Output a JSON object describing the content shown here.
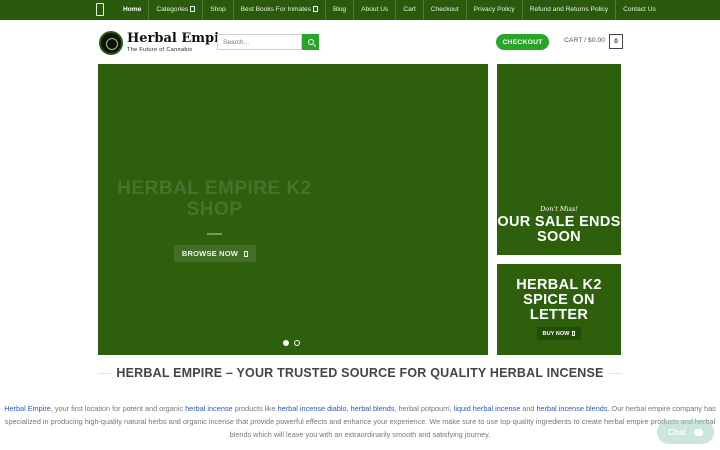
{
  "nav": {
    "items": [
      {
        "label": "Home"
      },
      {
        "label": "Categories"
      },
      {
        "label": "Shop"
      },
      {
        "label": "Best Books For Inmates"
      },
      {
        "label": "Blog"
      },
      {
        "label": "About Us"
      },
      {
        "label": "Cart"
      },
      {
        "label": "Checkout"
      },
      {
        "label": "Privacy Policy"
      },
      {
        "label": "Refund and Returns Policy"
      },
      {
        "label": "Contact Us"
      }
    ]
  },
  "header": {
    "logo_title": "Herbal Empire",
    "logo_subtitle": "The Future of Cannabis",
    "search_placeholder": "Search...",
    "checkout_label": "CHECKOUT",
    "cart_label": "CART / $0.00",
    "cart_count": "0"
  },
  "hero": {
    "title": "HERBAL EMPIRE K2 SHOP",
    "button_label": "BROWSE NOW",
    "slide_count": 2,
    "active_slide": 1
  },
  "promos": {
    "sale_tagline": "Don't Miss!",
    "sale_heading": "OUR SALE ENDS SOON",
    "spice_heading": "HERBAL K2 SPICE ON LETTER",
    "spice_button": "BUY NOW"
  },
  "section": {
    "title": "HERBAL EMPIRE – YOUR TRUSTED SOURCE FOR QUALITY HERBAL INCENSE"
  },
  "intro": {
    "l1": "Herbal Empire",
    "t1": ", your first location for potent and organic ",
    "l2": "herbal incense",
    "t2": " products like ",
    "l3": "herbal incense diablo",
    "t3": ", ",
    "l4": "herbal blends",
    "t4": ", herbal potpourri, ",
    "l5": "liquid herbal incense",
    "t5": " and ",
    "l6": "herbal incense blends",
    "t6": ". Our herbal empire company has specialized in producing high-quality natural herbs and organic incense that provide powerful effects and enhance your experience. We make sure to use top-quality ingredients to create herbal empire products and herbal blends which will leave you with an extraordinarily smooth and satisfying journey."
  },
  "chat": {
    "label": "Chat"
  },
  "colors": {
    "nav_bg": "#2a5b0c",
    "slide_bg": "#2d5f0d",
    "accent_green": "#2aa52a",
    "link_blue": "#2a5bb5"
  }
}
